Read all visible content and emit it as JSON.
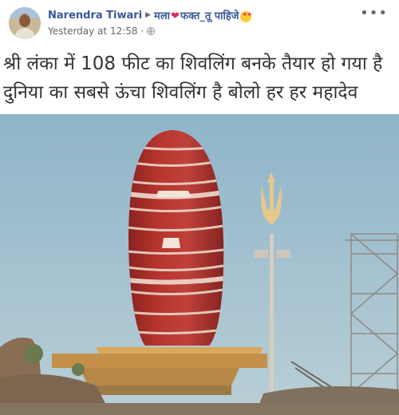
{
  "post": {
    "author": "Narendra Tiwari",
    "group": "मला",
    "group_suffix": "फक्त_तू पाहिजे",
    "timestamp": "Yesterday at 12:58",
    "privacy_icon": "globe-icon",
    "more_icon": "more-options-icon"
  },
  "photo": {
    "caption_line1": "श्री लंका में 108 फीट का शिवलिंग बनके तैयार हो गया है",
    "caption_line2": "दुनिया का सबसे ऊंचा शिवलिंग है बोलो हर हर महादेव"
  },
  "colors": {
    "link": "#385898",
    "meta": "#616770",
    "heart": "#e0245e"
  }
}
